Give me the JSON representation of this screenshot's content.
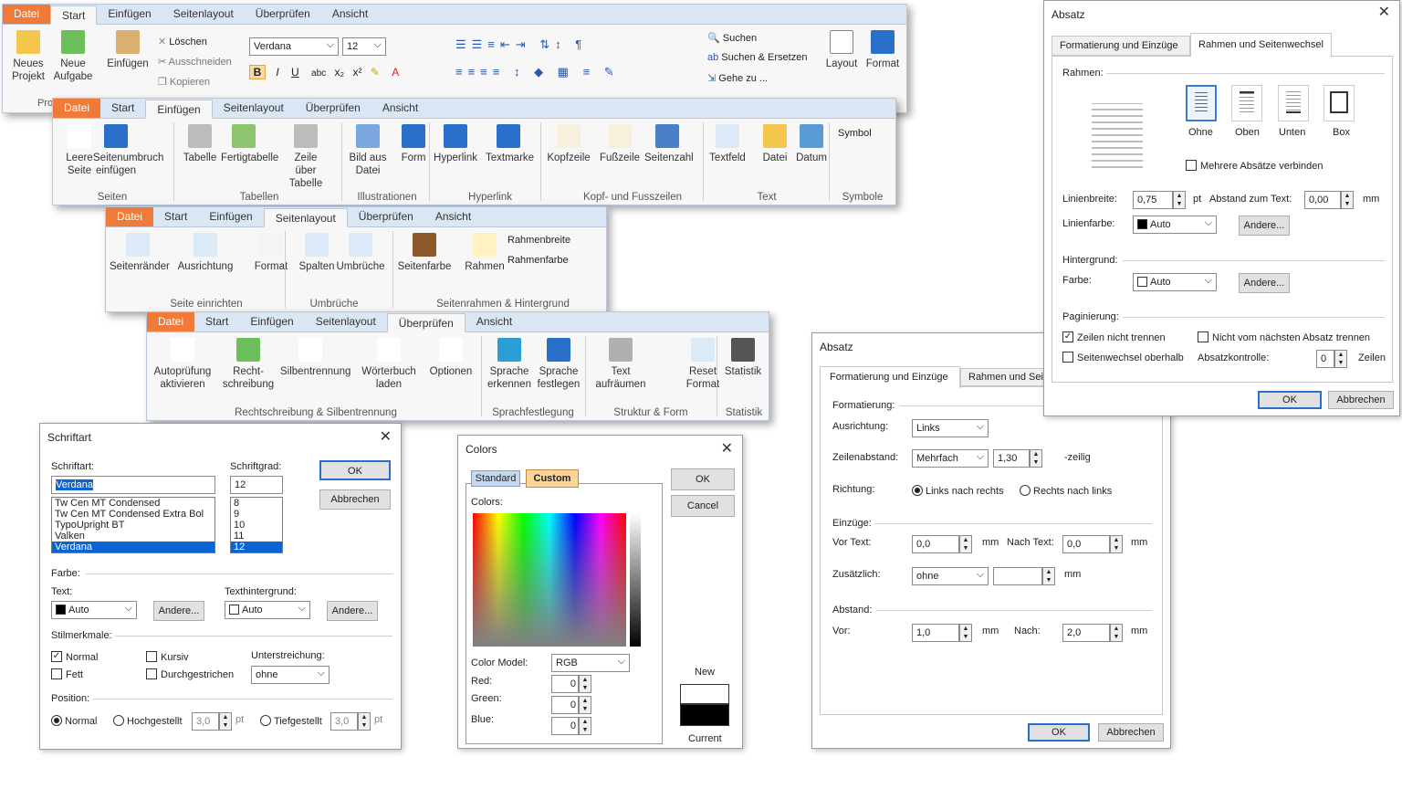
{
  "r1": {
    "tabs": [
      "Datei",
      "Start",
      "Einfügen",
      "Seitenlayout",
      "Überprüfen",
      "Ansicht"
    ],
    "neues_projekt": "Neues Projekt",
    "neue_aufgabe": "Neue Aufgabe",
    "einfuegen": "Einfügen",
    "loeschen": "Löschen",
    "ausschneiden": "Ausschneiden",
    "kopieren": "Kopieren",
    "font": "Verdana",
    "size": "12",
    "suchen": "Suchen",
    "suchen_ersetzen": "Suchen & Ersetzen",
    "gehe_zu": "Gehe zu ...",
    "layout": "Layout",
    "format": "Format",
    "pro": "Pro"
  },
  "r2": {
    "tabs": [
      "Datei",
      "Start",
      "Einfügen",
      "Seitenlayout",
      "Überprüfen",
      "Ansicht"
    ],
    "btns": [
      "Leere Seite",
      "Seitenumbruch einfügen",
      "Tabelle",
      "Fertigtabelle",
      "Zeile über Tabelle",
      "Bild aus Datei",
      "Form",
      "Hyperlink",
      "Textmarke",
      "Kopfzeile",
      "Fußzeile",
      "Seitenzahl",
      "Textfeld",
      "Datei",
      "Datum"
    ],
    "symbol": "Symbol",
    "groups": [
      "Seiten",
      "Tabellen",
      "Illustrationen",
      "Hyperlink",
      "Kopf- und Fusszeilen",
      "Text",
      "Symbole"
    ]
  },
  "r3": {
    "tabs": [
      "Datei",
      "Start",
      "Einfügen",
      "Seitenlayout",
      "Überprüfen",
      "Ansicht"
    ],
    "btns": [
      "Seitenränder",
      "Ausrichtung",
      "Format",
      "Spalten",
      "Umbrüche",
      "Seitenfarbe",
      "Rahmen"
    ],
    "rahmenbreite": "Rahmenbreite",
    "rahmenfarbe": "Rahmenfarbe",
    "groups": [
      "Seite einrichten",
      "Umbrüche",
      "Seitenrahmen & Hintergrund"
    ]
  },
  "r4": {
    "tabs": [
      "Datei",
      "Start",
      "Einfügen",
      "Seitenlayout",
      "Überprüfen",
      "Ansicht"
    ],
    "btns": [
      "Autoprüfung aktivieren",
      "Recht- schreibung",
      "Silbentrennung",
      "Wörterbuch laden",
      "Optionen",
      "Sprache erkennen",
      "Sprache festlegen",
      "Text aufräumen",
      "Reset Format",
      "Statistik"
    ],
    "groups": [
      "Rechtschreibung & Silbentrennung",
      "Sprachfestlegung",
      "Struktur & Form",
      "Statistik"
    ]
  },
  "font": {
    "title": "Schriftart",
    "schriftart": "Schriftart:",
    "schriftgrad": "Schriftgrad:",
    "font_value": "Verdana",
    "size_value": "12",
    "fonts": [
      "Tw Cen MT Condensed",
      "Tw Cen MT Condensed Extra Bol",
      "TypoUpright BT",
      "Valken",
      "Verdana"
    ],
    "sizes": [
      "8",
      "9",
      "10",
      "11",
      "12"
    ],
    "ok": "OK",
    "abbrechen": "Abbrechen",
    "farbe": "Farbe:",
    "text": "Text:",
    "texthintergrund": "Texthintergrund:",
    "auto": "Auto",
    "andere": "Andere...",
    "stilmerkmale": "Stilmerkmale:",
    "normal": "Normal",
    "fett": "Fett",
    "kursiv": "Kursiv",
    "durchgestrichen": "Durchgestrichen",
    "unterstreichung": "Unterstreichung:",
    "ohne": "ohne",
    "position": "Position:",
    "hochgestellt": "Hochgestellt",
    "tiefgestellt": "Tiefgestellt",
    "pos_val": "3,0",
    "pt": "pt"
  },
  "colors": {
    "title": "Colors",
    "standard": "Standard",
    "custom": "Custom",
    "colors_lbl": "Colors:",
    "ok": "OK",
    "cancel": "Cancel",
    "model_lbl": "Color Model:",
    "model": "RGB",
    "red": "Red:",
    "green": "Green:",
    "blue": "Blue:",
    "r": "0",
    "g": "0",
    "b": "0",
    "new": "New",
    "current": "Current"
  },
  "absatz1": {
    "title": "Absatz",
    "tab1": "Formatierung und Einzüge",
    "tab2": "Rahmen und Seitenwechsel",
    "formatierung": "Formatierung:",
    "ausrichtung": "Ausrichtung:",
    "links": "Links",
    "zeilenabstand": "Zeilenabstand:",
    "mehrfach": "Mehrfach",
    "zeil_val": "1,30",
    "zeilig": "-zeilig",
    "richtung": "Richtung:",
    "lnr": "Links nach rechts",
    "rnl": "Rechts nach links",
    "einzuege": "Einzüge:",
    "vortext": "Vor Text:",
    "vortext_val": "0,0",
    "nachtext": "Nach Text:",
    "nachtext_val": "0,0",
    "mm": "mm",
    "zusaetzlich": "Zusätzlich:",
    "ohne": "ohne",
    "abstand": "Abstand:",
    "vor": "Vor:",
    "vor_val": "1,0",
    "nach": "Nach:",
    "nach_val": "2,0",
    "ok": "OK",
    "abbrechen": "Abbrechen"
  },
  "absatz2": {
    "title": "Absatz",
    "tab1": "Formatierung und Einzüge",
    "tab2": "Rahmen und Seitenwechsel",
    "rahmen": "Rahmen:",
    "ohne": "Ohne",
    "oben": "Oben",
    "unten": "Unten",
    "box": "Box",
    "mehrere": "Mehrere Absätze verbinden",
    "linienbreite": "Linienbreite:",
    "lb_val": "0,75",
    "pt": "pt",
    "abstand_text": "Abstand zum Text:",
    "at_val": "0,00",
    "mm": "mm",
    "linienfarbe": "Linienfarbe:",
    "auto": "Auto",
    "andere": "Andere...",
    "hintergrund": "Hintergrund:",
    "farbe": "Farbe:",
    "paginierung": "Paginierung:",
    "zeilen_nicht": "Zeilen nicht trennen",
    "nicht_vom": "Nicht vom nächsten Absatz trennen",
    "seitenwechsel": "Seitenwechsel oberhalb",
    "absatzkontrolle": "Absatzkontrolle:",
    "ak_val": "0",
    "zeilen": "Zeilen",
    "ok": "OK",
    "abbrechen": "Abbrechen"
  },
  "colors_accent": {
    "file_tab": "#f07a3a",
    "blue": "#2a6fc9"
  }
}
